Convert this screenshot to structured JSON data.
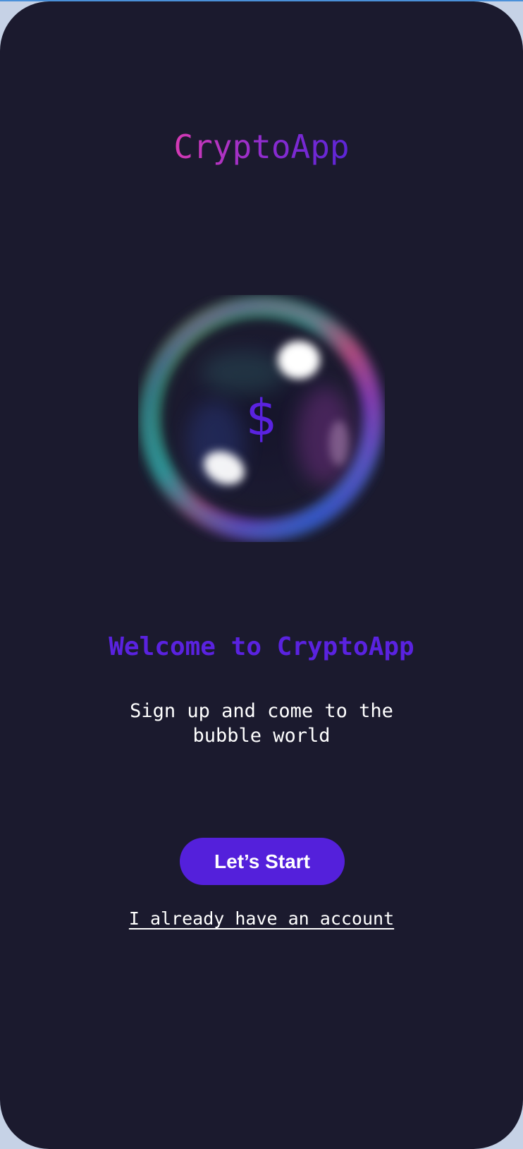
{
  "app": {
    "logo_text": "CryptoApp"
  },
  "hero": {
    "icon": "bubble-dollar-icon",
    "currency_symbol": "$"
  },
  "welcome": {
    "title": "Welcome to CryptoApp",
    "subtitle": "Sign up and come to the bubble world"
  },
  "actions": {
    "start_label": "Let’s Start",
    "login_label": "I already have an account"
  },
  "colors": {
    "background": "#1b1a2e",
    "accent": "#5420db",
    "logo_gradient_start": "#d63ab4",
    "logo_gradient_end": "#5b25d6",
    "text": "#ffffff"
  }
}
